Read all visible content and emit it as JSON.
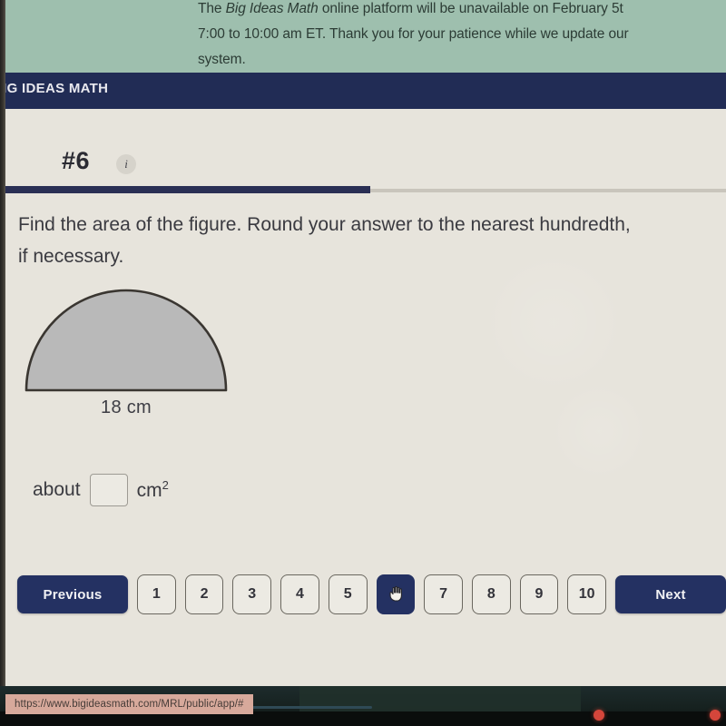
{
  "banner": {
    "line1_a": "The ",
    "line1_em": "Big Ideas Math",
    "line1_b": " online platform will be unavailable on February 5t",
    "line2": "7:00 to 10:00 am ET. Thank you for your patience while we update our",
    "line3": "system.",
    "bg_color": "#9dbfae"
  },
  "header": {
    "brand": "BIG IDEAS MATH",
    "bg_color": "#212c56"
  },
  "question": {
    "number_label": "#6",
    "info_icon_glyph": "i",
    "progress_percent": 51,
    "prompt": "Find the area of the figure. Round your answer to the nearest hundredth, if necessary."
  },
  "figure": {
    "shape": "semicircle",
    "fill_color": "#b9b9b9",
    "stroke_color": "#3a3631",
    "dimension_label": "18 cm"
  },
  "answer": {
    "prefix": "about",
    "value": "",
    "placeholder": "",
    "unit": "cm",
    "unit_exponent": "2"
  },
  "pager": {
    "previous_label": "Previous",
    "next_label": "Next",
    "active_index": 6,
    "active_cursor_icon": "pointing-hand-cursor",
    "pages": [
      "1",
      "2",
      "3",
      "4",
      "5",
      "6",
      "7",
      "8",
      "9",
      "10"
    ],
    "active_color": "#243164"
  },
  "statusbar": {
    "url": "https://www.bigideasmath.com/MRL/public/app/#"
  }
}
